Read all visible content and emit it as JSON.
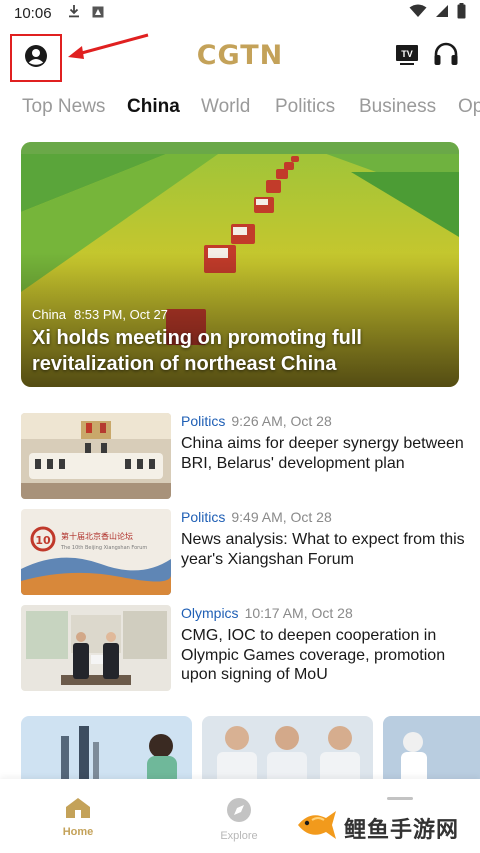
{
  "status_bar": {
    "time": "10:06",
    "icons": [
      "download-icon",
      "notification-icon",
      "wifi-icon",
      "signal-icon",
      "battery-icon"
    ]
  },
  "header": {
    "logo": "CGTN",
    "icons": [
      "profile-icon",
      "tv-icon",
      "headphones-icon"
    ],
    "tv_label": "TV",
    "highlight_color": "#e02020"
  },
  "tabs": [
    {
      "label": "Top News",
      "active": false
    },
    {
      "label": "China",
      "active": true
    },
    {
      "label": "World",
      "active": false
    },
    {
      "label": "Politics",
      "active": false
    },
    {
      "label": "Business",
      "active": false
    },
    {
      "label": "Op",
      "active": false
    }
  ],
  "hero": {
    "category": "China",
    "time": "8:53 PM, Oct 27",
    "title": "Xi holds meeting on promoting full revitalization of northeast China"
  },
  "news": [
    {
      "category": "Politics",
      "time": "9:26 AM, Oct 28",
      "title": "China aims for deeper synergy between BRI, Belarus' development plan"
    },
    {
      "category": "Politics",
      "time": "9:49 AM, Oct 28",
      "title": "News analysis: What to expect from this year's Xiangshan Forum",
      "thumb_text": "第十届北京香山论坛",
      "thumb_subtext": "The 10th Beijing Xiangshan Forum"
    },
    {
      "category": "Olympics",
      "time": "10:17 AM, Oct 28",
      "title": "CMG, IOC to deepen cooperation in Olympic Games coverage, promotion upon signing of MoU"
    }
  ],
  "bottom_nav": [
    {
      "label": "Home",
      "icon": "home-icon",
      "active": true
    },
    {
      "label": "Explore",
      "icon": "compass-icon",
      "active": false
    }
  ],
  "watermark": {
    "text": "鲤鱼手游网"
  },
  "colors": {
    "accent": "#c4a259",
    "category": "#1f5fb5",
    "muted": "#9a9a9a"
  }
}
